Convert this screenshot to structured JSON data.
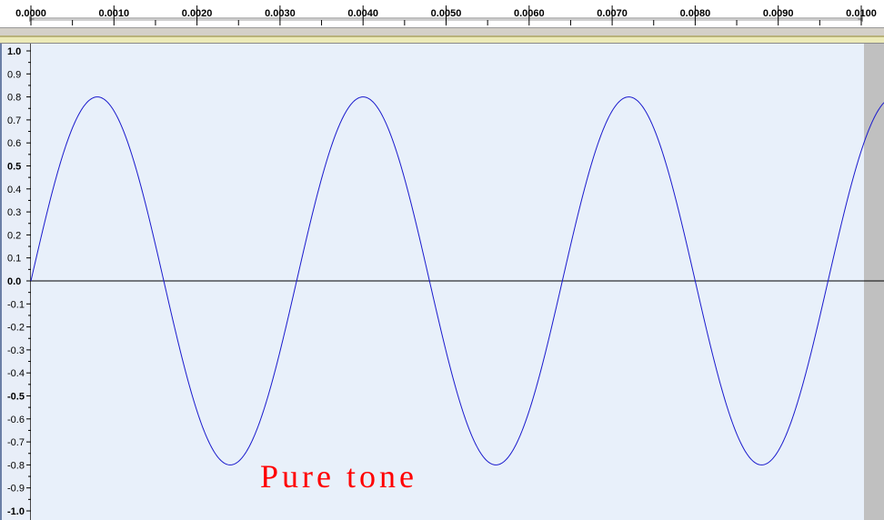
{
  "timeline": {
    "tick_labels": [
      "0.0000",
      "0.0010",
      "0.0020",
      "0.0030",
      "0.0040",
      "0.0050",
      "0.0060",
      "0.0070",
      "0.0080",
      "0.0090",
      "0.0100"
    ],
    "range": [
      0.0,
      0.01
    ]
  },
  "track": {
    "amplitude_labels": [
      "1.0",
      "0.9",
      "0.8",
      "0.7",
      "0.6",
      "0.5",
      "0.4",
      "0.3",
      "0.2",
      "0.1",
      "0.0",
      "-0.1",
      "-0.2",
      "-0.3",
      "-0.4",
      "-0.5",
      "-0.6",
      "-0.7",
      "-0.8",
      "-0.9",
      "-1.0"
    ],
    "amplitude_range": [
      -1.0,
      1.0
    ],
    "annotation": "Pure tone"
  },
  "waveform": {
    "amplitude": 0.8,
    "period": 0.0032,
    "phase_start": 0.0,
    "visible_end": 0.0102
  },
  "colors": {
    "plot_bg": "#e8f0fa",
    "beyond_end_bg": "#c0c0c0",
    "wave": "#1a1acd",
    "zero_line": "#000000",
    "annotation": "#ff0000"
  }
}
